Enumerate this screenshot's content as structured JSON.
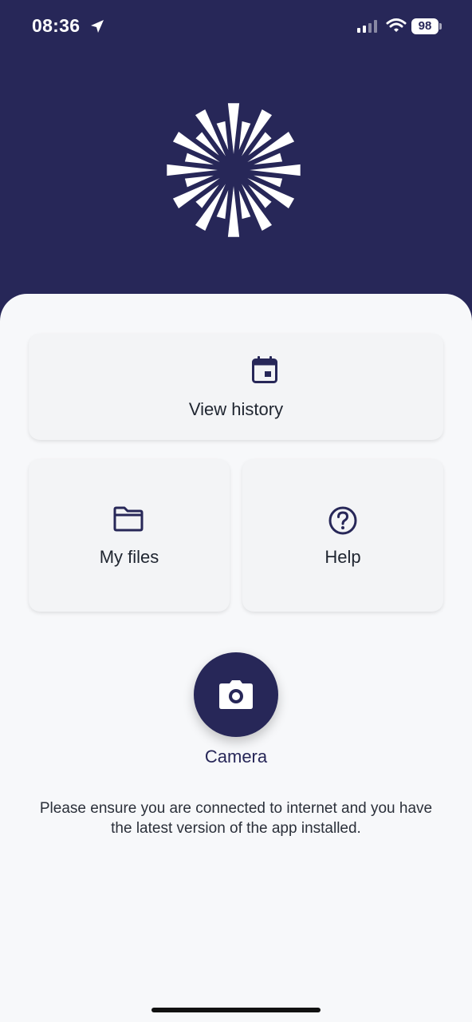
{
  "status_bar": {
    "time": "08:36",
    "battery": "98"
  },
  "icons": {
    "location": "location-arrow-icon",
    "signal": "cellular-signal-icon",
    "wifi": "wifi-icon",
    "logo": "starburst-logo",
    "history": "calendar-icon",
    "files": "folder-icon",
    "help": "question-circle-icon",
    "camera": "camera-icon"
  },
  "colors": {
    "brand": "#272758",
    "card_background": "#f3f4f6",
    "page_background": "#f7f8fa"
  },
  "menu": {
    "view_history": "View history",
    "my_files": "My files",
    "help": "Help"
  },
  "camera": {
    "label": "Camera"
  },
  "notice": "Please ensure you are connected to internet and you have the latest version of the app installed."
}
